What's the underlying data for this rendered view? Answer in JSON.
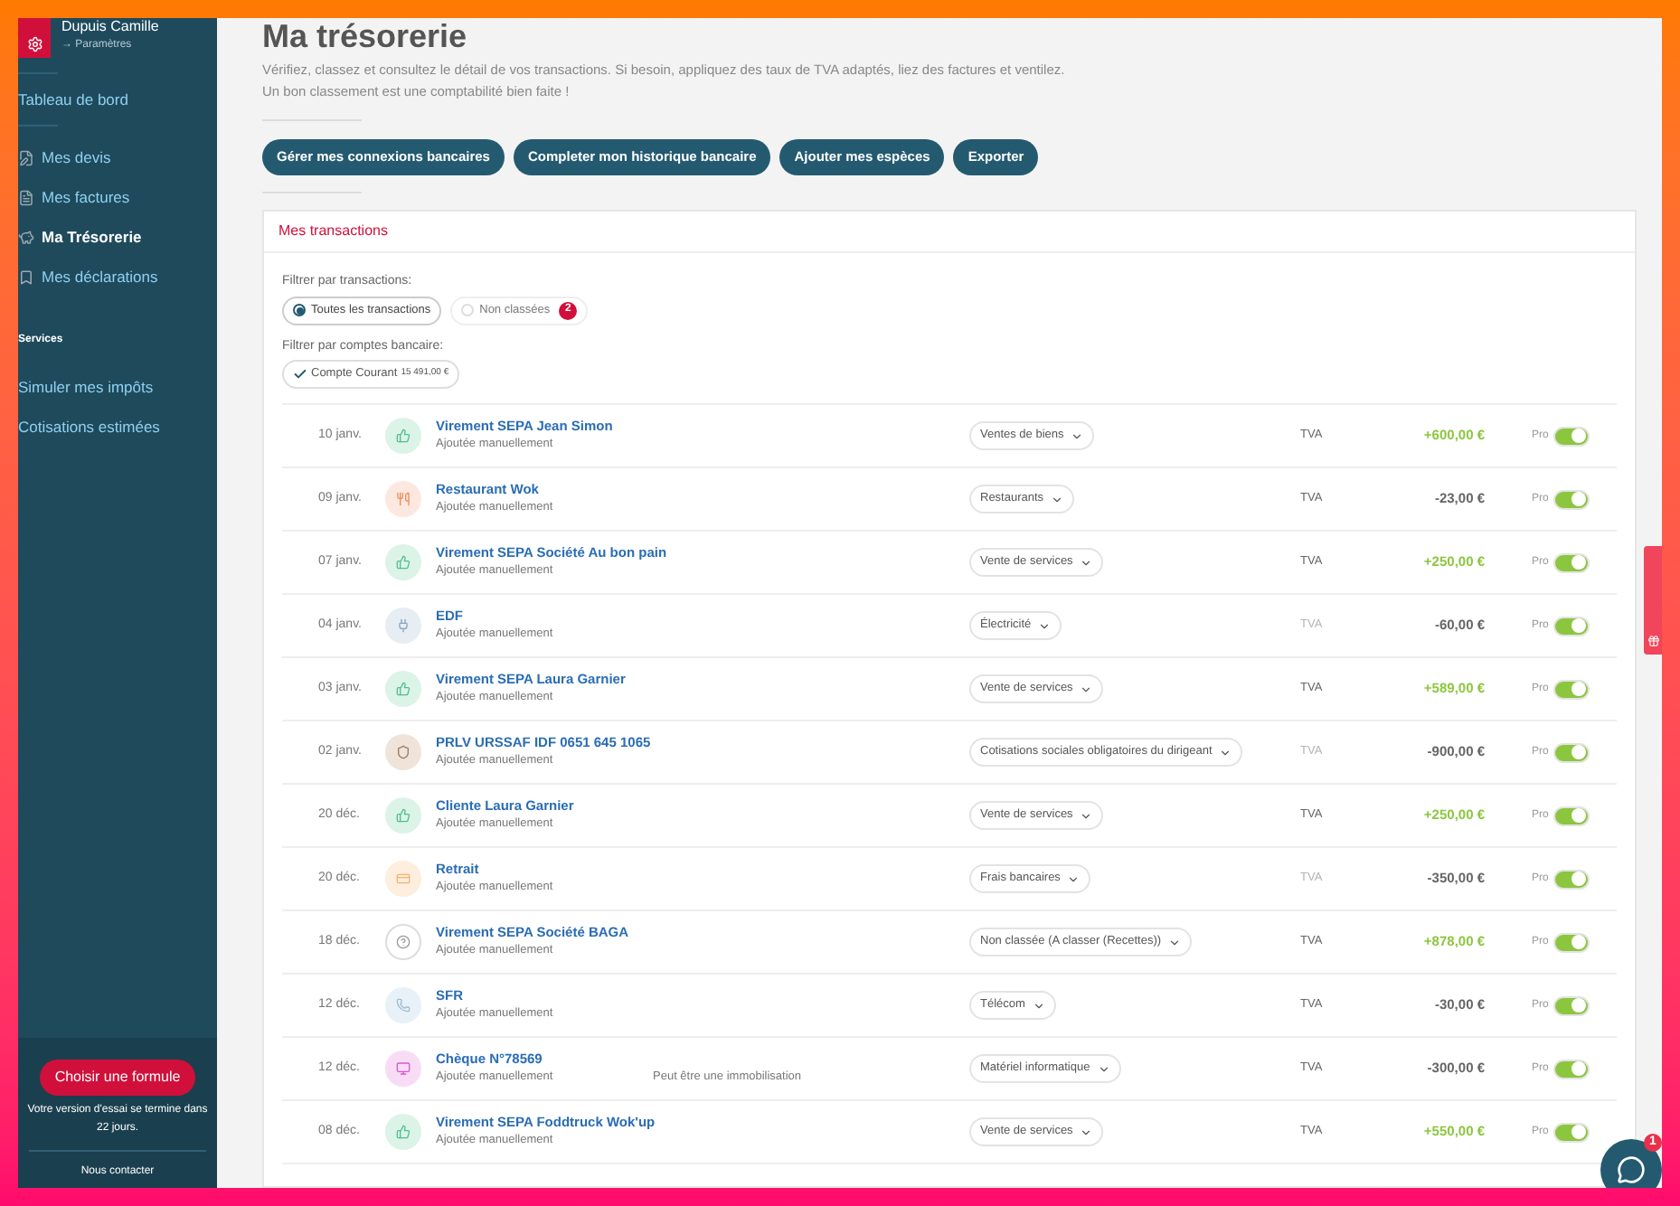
{
  "sidebar": {
    "user_name": "Dupuis Camille",
    "settings_link": "→ Paramètres",
    "items": [
      {
        "label": "Tableau de bord",
        "kind": "plain",
        "selected": false
      },
      {
        "label": "Mes devis",
        "kind": "quote",
        "selected": false
      },
      {
        "label": "Mes factures",
        "kind": "invoice",
        "selected": false
      },
      {
        "label": "Ma Trésorerie",
        "kind": "piggy",
        "selected": true
      },
      {
        "label": "Mes déclarations",
        "kind": "bookmark",
        "selected": false
      }
    ],
    "section_title": "Services",
    "service_items": [
      {
        "label": "Simuler mes impôts",
        "selected": false
      },
      {
        "label": "Cotisations estimées",
        "selected": false
      }
    ],
    "cta_button": "Choisir une formule",
    "trial_text": "Votre version d'essai se termine dans 22 jours.",
    "contact_link": "Nous contacter"
  },
  "page": {
    "title": "Ma trésorerie",
    "description": [
      "Vérifiez, classez et consultez le détail de vos transactions. Si besoin, appliquez des taux de TVA adaptés, liez des factures et ventilez.",
      "Un bon classement est une comptabilité bien faite !"
    ],
    "actions": [
      "Gérer mes connexions bancaires",
      "Completer mon historique bancaire",
      "Ajouter mes espèces",
      "Exporter"
    ]
  },
  "transactions": {
    "title": "Mes transactions",
    "filter_label": "Filtrer par transactions:",
    "filters": [
      {
        "label": "Toutes les transactions",
        "selected": true
      },
      {
        "label": "Non classées",
        "selected": false,
        "count": "2"
      }
    ],
    "account_filter_label": "Filtrer par comptes bancaire:",
    "account_filter": {
      "label": "Compte Courant",
      "amount": "15 491,00 €",
      "checked": true
    },
    "rows": [
      {
        "date": "10 janv.",
        "kind": "thumb",
        "name": "Virement SEPA Jean Simon",
        "source": "Ajoutée manuellement",
        "category": "Ventes de biens",
        "tva": "TVA",
        "tva_dim": false,
        "amount": "+600,00 €",
        "credit": true,
        "pro_label": "Pro",
        "pro_on": true
      },
      {
        "date": "09 janv.",
        "kind": "food",
        "name": "Restaurant Wok",
        "source": "Ajoutée manuellement",
        "category": "Restaurants",
        "tva": "TVA",
        "tva_dim": false,
        "amount": "-23,00 €",
        "credit": false,
        "pro_label": "Pro",
        "pro_on": true
      },
      {
        "date": "07 janv.",
        "kind": "thumb",
        "name": "Virement SEPA Société Au bon pain",
        "source": "Ajoutée manuellement",
        "category": "Vente de services",
        "tva": "TVA",
        "tva_dim": false,
        "amount": "+250,00 €",
        "credit": true,
        "pro_label": "Pro",
        "pro_on": true
      },
      {
        "date": "04 janv.",
        "kind": "plug",
        "name": "EDF",
        "source": "Ajoutée manuellement",
        "category": "Électricité",
        "tva": "TVA",
        "tva_dim": true,
        "amount": "-60,00 €",
        "credit": false,
        "pro_label": "Pro",
        "pro_on": true
      },
      {
        "date": "03 janv.",
        "kind": "thumb",
        "name": "Virement SEPA Laura Garnier",
        "source": "Ajoutée manuellement",
        "category": "Vente de services",
        "tva": "TVA",
        "tva_dim": false,
        "amount": "+589,00 €",
        "credit": true,
        "pro_label": "Pro",
        "pro_on": true
      },
      {
        "date": "02 janv.",
        "kind": "shield",
        "name": "PRLV URSSAF IDF 0651 645 1065",
        "source": "Ajoutée manuellement",
        "category": "Cotisations sociales obligatoires du dirigeant",
        "tva": "TVA",
        "tva_dim": true,
        "amount": "-900,00 €",
        "credit": false,
        "pro_label": "Pro",
        "pro_on": true
      },
      {
        "date": "20 déc.",
        "kind": "thumb",
        "name": "Cliente Laura Garnier",
        "source": "Ajoutée manuellement",
        "category": "Vente de services",
        "tva": "TVA",
        "tva_dim": false,
        "amount": "+250,00 €",
        "credit": true,
        "pro_label": "Pro",
        "pro_on": true
      },
      {
        "date": "20 déc.",
        "kind": "card",
        "name": "Retrait",
        "source": "Ajoutée manuellement",
        "category": "Frais bancaires",
        "tva": "TVA",
        "tva_dim": true,
        "amount": "-350,00 €",
        "credit": false,
        "pro_label": "Pro",
        "pro_on": true
      },
      {
        "date": "18 déc.",
        "kind": "question",
        "name": "Virement SEPA Société BAGA",
        "source": "Ajoutée manuellement",
        "category": "Non classée (A classer (Recettes))",
        "tva": "TVA",
        "tva_dim": false,
        "amount": "+878,00 €",
        "credit": true,
        "pro_label": "Pro",
        "pro_on": true
      },
      {
        "date": "12 déc.",
        "kind": "phone",
        "name": "SFR",
        "source": "Ajoutée manuellement",
        "category": "Télécom",
        "tva": "TVA",
        "tva_dim": false,
        "amount": "-30,00 €",
        "credit": false,
        "pro_label": "Pro",
        "pro_on": true
      },
      {
        "date": "12 déc.",
        "kind": "monitor",
        "name": "Chèque N°78569",
        "source": "Ajoutée manuellement",
        "note": "Peut être une immobilisation",
        "category": "Matériel informatique",
        "tva": "TVA",
        "tva_dim": false,
        "amount": "-300,00 €",
        "credit": false,
        "pro_label": "Pro",
        "pro_on": true
      },
      {
        "date": "08 déc.",
        "kind": "thumb",
        "name": "Virement SEPA Foddtruck Wok'up",
        "source": "Ajoutée manuellement",
        "category": "Vente de services",
        "tva": "TVA",
        "tva_dim": false,
        "amount": "+550,00 €",
        "credit": true,
        "pro_label": "Pro",
        "pro_on": true
      }
    ]
  },
  "chat": {
    "badge": "1"
  }
}
